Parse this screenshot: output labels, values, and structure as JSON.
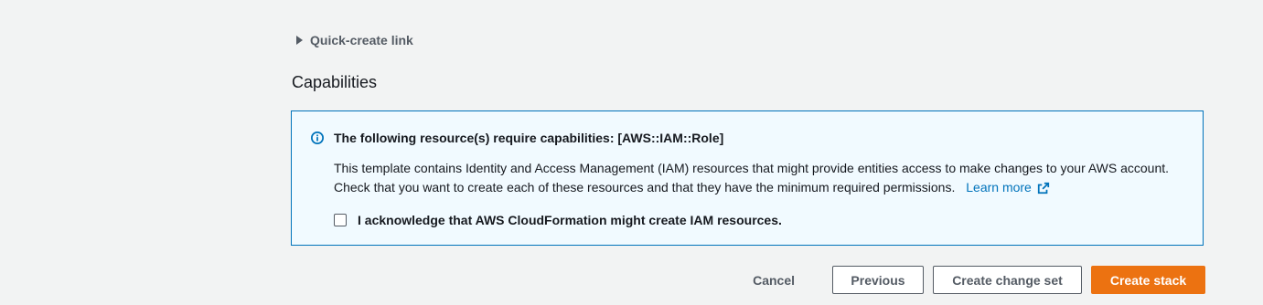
{
  "quick_create": {
    "label": "Quick-create link",
    "icon": "caret-right-icon"
  },
  "capabilities": {
    "title": "Capabilities"
  },
  "alert": {
    "icon": "info-icon",
    "title": "The following resource(s) require capabilities: [AWS::IAM::Role]",
    "body_line1": "This template contains Identity and Access Management (IAM) resources that might provide entities access to make changes to your AWS account.",
    "body_line2": "Check that you want to create each of these resources and that they have the minimum required permissions.",
    "learn_more": "Learn more",
    "learn_more_icon": "external-link-icon",
    "acknowledge_label": "I acknowledge that AWS CloudFormation might create IAM resources.",
    "acknowledge_checked": false,
    "accent_color": "#0073bb"
  },
  "actions": {
    "cancel": "Cancel",
    "previous": "Previous",
    "create_change_set": "Create change set",
    "create_stack": "Create stack",
    "primary_color": "#ec7211"
  }
}
